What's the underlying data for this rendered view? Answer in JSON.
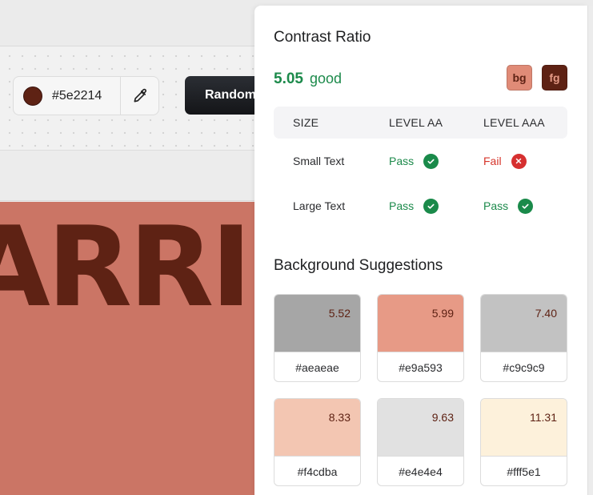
{
  "toolbar": {
    "color_value": "#5e2214",
    "swatch_color": "#5e2214",
    "random_label": "Random"
  },
  "preview": {
    "word": "ARRI"
  },
  "panel": {
    "title": "Contrast Ratio",
    "ratio_value": "5.05",
    "ratio_label": "good",
    "bg_chip": "bg",
    "fg_chip": "fg",
    "table": {
      "headers": [
        "SIZE",
        "LEVEL AA",
        "LEVEL AAA"
      ],
      "rows": [
        {
          "size": "Small Text",
          "aa": "Pass",
          "aaa": "Fail"
        },
        {
          "size": "Large Text",
          "aa": "Pass",
          "aaa": "Pass"
        }
      ]
    },
    "suggestions_title": "Background Suggestions",
    "suggestions": [
      {
        "hex": "#aeaeae",
        "ratio": "5.52",
        "color": "#a6a6a6"
      },
      {
        "hex": "#e9a593",
        "ratio": "5.99",
        "color": "#e79a86"
      },
      {
        "hex": "#c9c9c9",
        "ratio": "7.40",
        "color": "#c2c2c2"
      },
      {
        "hex": "#f4cdba",
        "ratio": "8.33",
        "color": "#f3c6b2"
      },
      {
        "hex": "#e4e4e4",
        "ratio": "9.63",
        "color": "#e1e1e1"
      },
      {
        "hex": "#fff5e1",
        "ratio": "11.31",
        "color": "#fdf1db"
      }
    ]
  }
}
